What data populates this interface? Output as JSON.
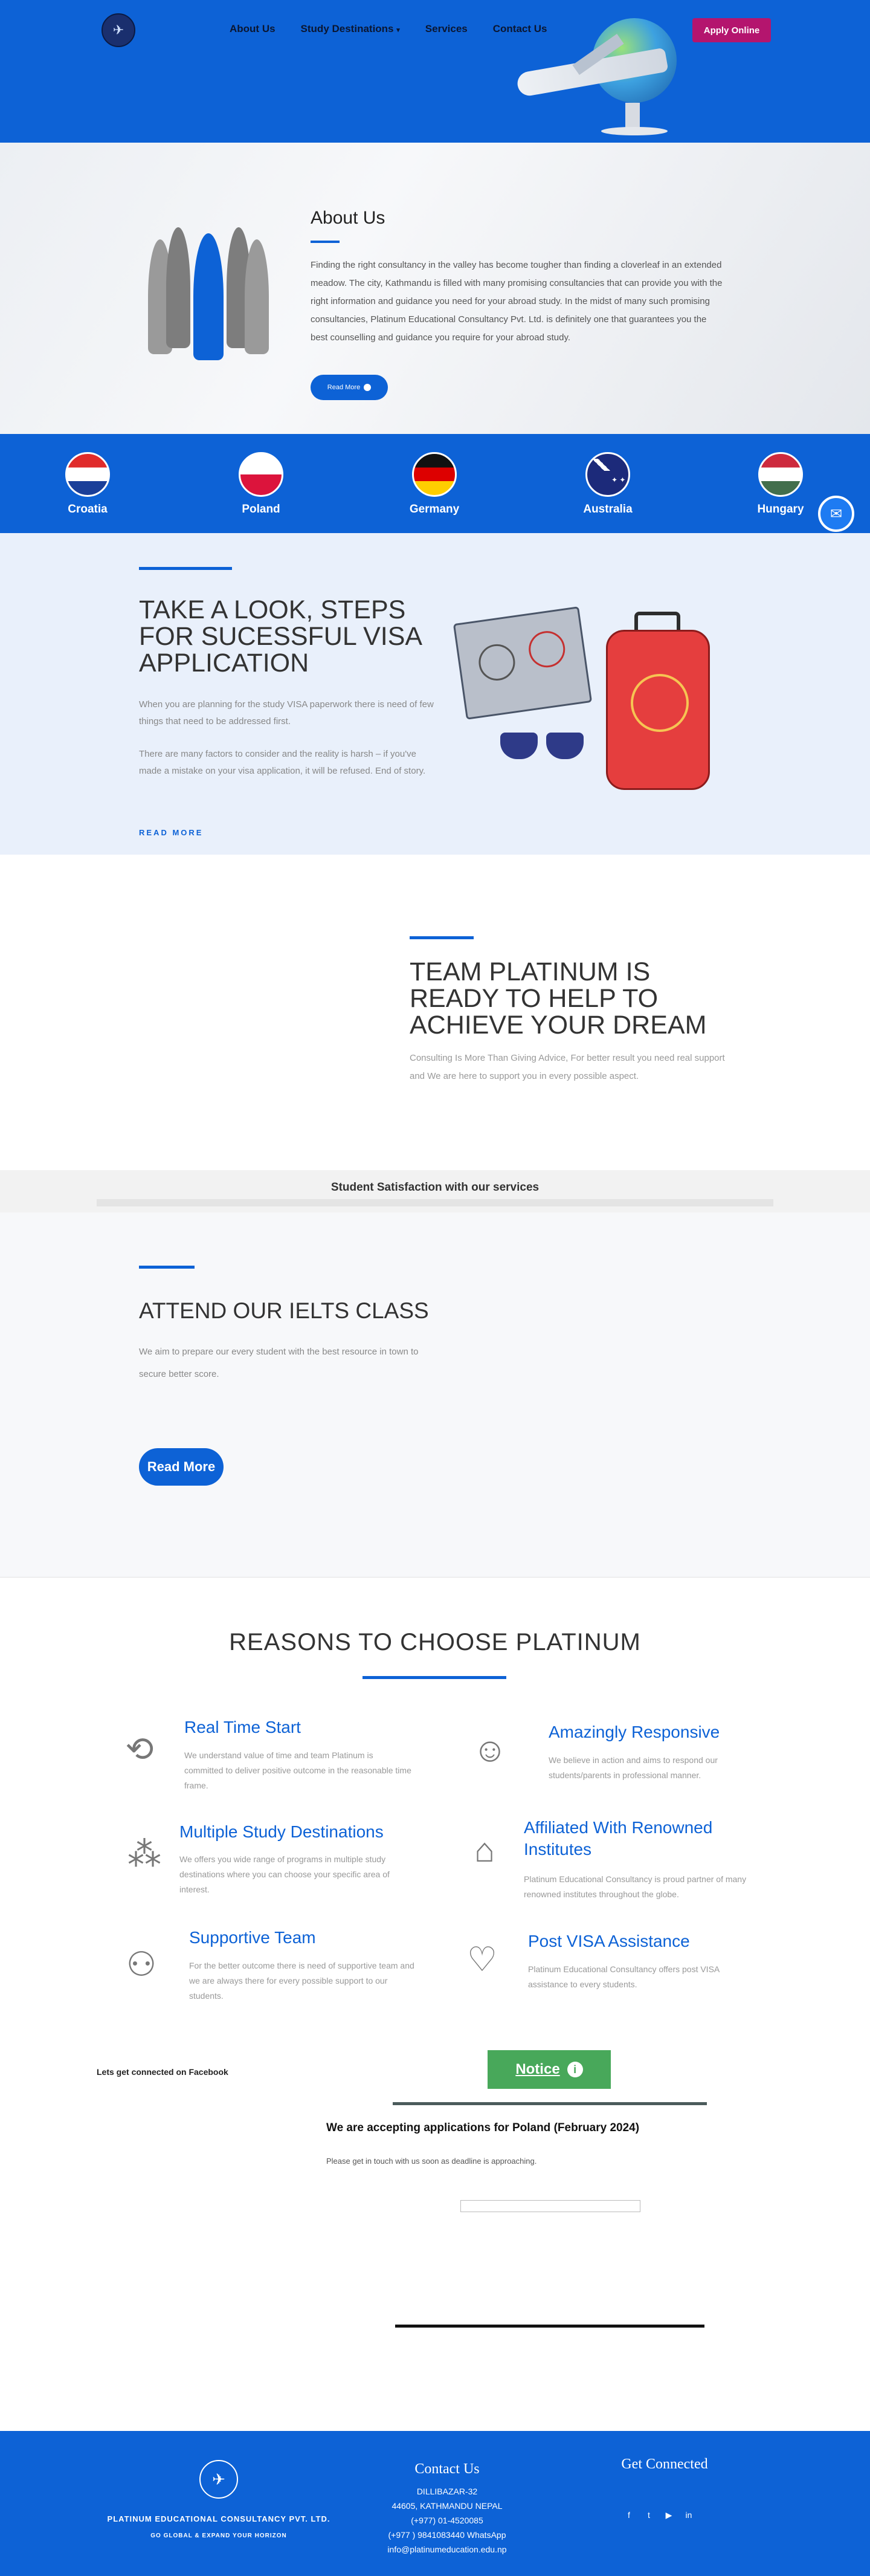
{
  "header": {
    "logo_icon": "platinum-logo",
    "nav": [
      "About Us",
      "Study Destinations",
      "Services",
      "Contact Us"
    ],
    "nav_dropdown_icon": "chevron-down-icon",
    "apply_label": "Apply Online",
    "colors": {
      "brand_blue": "#0d62d6",
      "apply": "#b4156e"
    }
  },
  "about": {
    "title": "About Us",
    "text": "Finding the right consultancy in the valley has become tougher than finding a cloverleaf in an extended meadow. The city, Kathmandu is filled with many promising consultancies that can provide you with the right information and guidance you need for your abroad study. In the midst of many such promising consultancies, Platinum Educational Consultancy Pvt. Ltd. is definitely one that guarantees you the best counselling and guidance you require for your abroad study.",
    "read_more": "Read More"
  },
  "flags": [
    {
      "label": "Croatia"
    },
    {
      "label": "Poland"
    },
    {
      "label": "Germany"
    },
    {
      "label": "Australia"
    },
    {
      "label": "Hungary"
    }
  ],
  "steps": {
    "title": "TAKE A LOOK, STEPS FOR SUCESSFUL VISA APPLICATION",
    "p1": "When you are planning for the study VISA paperwork there is need of few things that need to be addressed first.",
    "p2": "There are many factors to consider and the reality is harsh – if you've made a mistake on your visa application, it will be refused. End of story.",
    "link": "READ MORE"
  },
  "team": {
    "title": "TEAM PLATINUM IS READY TO HELP TO ACHIEVE YOUR DREAM",
    "text": "Consulting Is More Than Giving Advice, For better result you need real support and We are here to support you in every possible aspect."
  },
  "satisfaction": {
    "title": "Student Satisfaction with our services"
  },
  "ielts": {
    "title": "ATTEND OUR IELTS CLASS",
    "text": "We aim to prepare our every student with the best resource in town to secure better score.",
    "button": "Read More"
  },
  "reasons": {
    "title": "REASONS TO CHOOSE PLATINUM",
    "items": [
      {
        "title": "Real Time Start",
        "text": "We understand value of time and team Platinum is committed to deliver positive outcome in the reasonable time frame.",
        "icon": "clock-icon"
      },
      {
        "title": "Amazingly Responsive",
        "text": "We believe in action and aims to respond our students/parents in professional manner.",
        "icon": "responsive-person-icon"
      },
      {
        "title": "Multiple Study Destinations",
        "text": "We offers you wide range of programs in multiple study destinations where you can choose your specific area of interest.",
        "icon": "network-icon"
      },
      {
        "title": "Affiliated With Renowned Institutes",
        "text": "Platinum Educational Consultancy is proud partner of many renowned institutes throughout the globe.",
        "icon": "institute-building-icon"
      },
      {
        "title": "Supportive Team",
        "text": "For the better outcome there is need of supportive team and we are always there for every possible support to our students.",
        "icon": "team-icon"
      },
      {
        "title": "Post VISA Assistance",
        "text": "Platinum Educational Consultancy offers post VISA assistance to every students.",
        "icon": "hands-heart-icon"
      }
    ]
  },
  "connect": {
    "fb_label": "Lets get connected on Facebook",
    "notice_label": "Notice",
    "notice_heading": "We are accepting applications for Poland (February 2024)",
    "notice_sub": "Please get in touch with us soon as deadline is approaching."
  },
  "footer": {
    "company": "PLATINUM EDUCATIONAL CONSULTANCY PVT. LTD.",
    "tagline": "GO GLOBAL & EXPAND YOUR HORIZON",
    "contact_title": "Contact Us",
    "contact_lines": [
      "DILLIBAZAR-32",
      "44605, KATHMANDU NEPAL",
      "(+977) 01-4520085",
      "(+977 ) 9841083440 WhatsApp",
      "info@platinumeducation.edu.np"
    ],
    "social_title": "Get Connected",
    "social_icons": [
      "facebook-icon",
      "twitter-icon",
      "youtube-icon",
      "linkedin-icon"
    ]
  }
}
